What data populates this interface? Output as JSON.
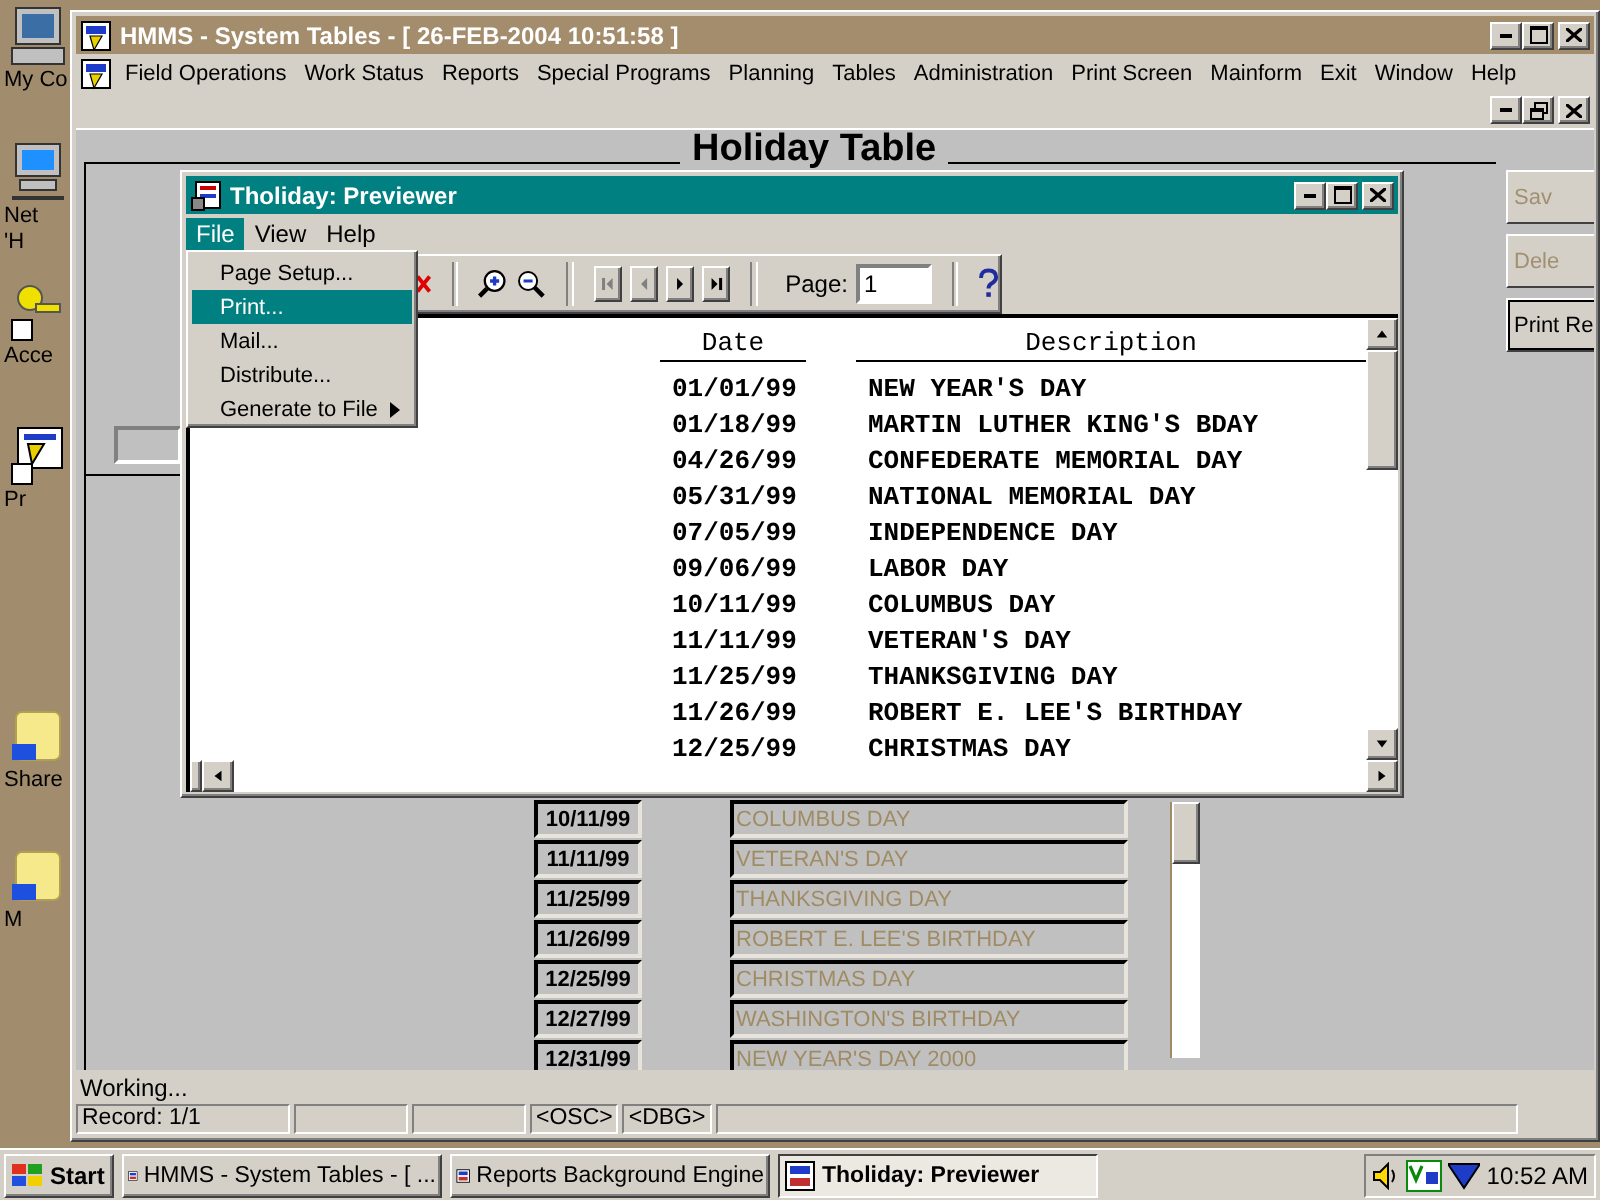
{
  "desktop_icons": [
    {
      "kind": "computer",
      "lines": [
        "My Co"
      ]
    },
    {
      "kind": "network",
      "lines": [
        "Net",
        "'H"
      ]
    },
    {
      "kind": "keys",
      "lines": [
        "Acce"
      ]
    },
    {
      "kind": "app",
      "lines": [
        "Pr"
      ]
    },
    {
      "kind": "folder",
      "lines": [
        "Share"
      ]
    },
    {
      "kind": "folder",
      "lines": [
        "M"
      ]
    }
  ],
  "main_window": {
    "title": "HMMS - System Tables - [ 26-FEB-2004 10:51:58 ]",
    "menu": [
      "Field Operations",
      "Work Status",
      "Reports",
      "Special Programs",
      "Planning",
      "Tables",
      "Administration",
      "Print Screen",
      "Mainform",
      "Exit",
      "Window",
      "Help"
    ],
    "form": {
      "heading": "Holiday Table",
      "actions": [
        {
          "label": "Sav",
          "disabled": true
        },
        {
          "label": "Dele",
          "disabled": true
        },
        {
          "label": "Print Re",
          "disabled": false
        }
      ],
      "rows": [
        {
          "date": "10/11/99",
          "description": "COLUMBUS DAY"
        },
        {
          "date": "11/11/99",
          "description": "VETERAN'S DAY"
        },
        {
          "date": "11/25/99",
          "description": "THANKSGIVING DAY"
        },
        {
          "date": "11/26/99",
          "description": "ROBERT E. LEE'S BIRTHDAY"
        },
        {
          "date": "12/25/99",
          "description": "CHRISTMAS DAY"
        },
        {
          "date": "12/27/99",
          "description": "WASHINGTON'S BIRTHDAY"
        },
        {
          "date": "12/31/99",
          "description": "NEW YEAR'S DAY 2000"
        }
      ]
    },
    "status_text": "Working...",
    "status_panels": [
      "Record: 1/1",
      "<OSC>",
      "<DBG>"
    ]
  },
  "previewer": {
    "title": "Tholiday: Previewer",
    "menu": [
      {
        "label": "File",
        "selected": true
      },
      {
        "label": "View",
        "selected": false
      },
      {
        "label": "Help",
        "selected": false
      }
    ],
    "file_menu": [
      {
        "label": "Page Setup...",
        "selected": false,
        "submenu": false
      },
      {
        "label": "Print...",
        "selected": true,
        "submenu": false
      },
      {
        "label": "Mail...",
        "selected": false,
        "submenu": false
      },
      {
        "label": "Distribute...",
        "selected": false,
        "submenu": false
      },
      {
        "label": "Generate to File",
        "selected": false,
        "submenu": true
      }
    ],
    "page_label": "Page:",
    "page_value": "1",
    "columns": [
      "Date",
      "Description"
    ],
    "rows": [
      {
        "date": "01/01/99",
        "description": "NEW YEAR'S DAY"
      },
      {
        "date": "01/18/99",
        "description": "MARTIN LUTHER KING'S BDAY"
      },
      {
        "date": "04/26/99",
        "description": "CONFEDERATE MEMORIAL DAY"
      },
      {
        "date": "05/31/99",
        "description": "NATIONAL MEMORIAL DAY"
      },
      {
        "date": "07/05/99",
        "description": "INDEPENDENCE DAY"
      },
      {
        "date": "09/06/99",
        "description": "LABOR DAY"
      },
      {
        "date": "10/11/99",
        "description": "COLUMBUS DAY"
      },
      {
        "date": "11/11/99",
        "description": "VETERAN'S DAY"
      },
      {
        "date": "11/25/99",
        "description": "THANKSGIVING DAY"
      },
      {
        "date": "11/26/99",
        "description": "ROBERT E. LEE'S BIRTHDAY"
      },
      {
        "date": "12/25/99",
        "description": "CHRISTMAS DAY"
      }
    ]
  },
  "taskbar": {
    "start": "Start",
    "tasks": [
      {
        "label": "HMMS - System Tables - [ ...",
        "selected": false
      },
      {
        "label": "Reports Background Engine",
        "selected": false
      },
      {
        "label": "Tholiday: Previewer",
        "selected": true
      }
    ],
    "clock": "10:52 AM"
  }
}
